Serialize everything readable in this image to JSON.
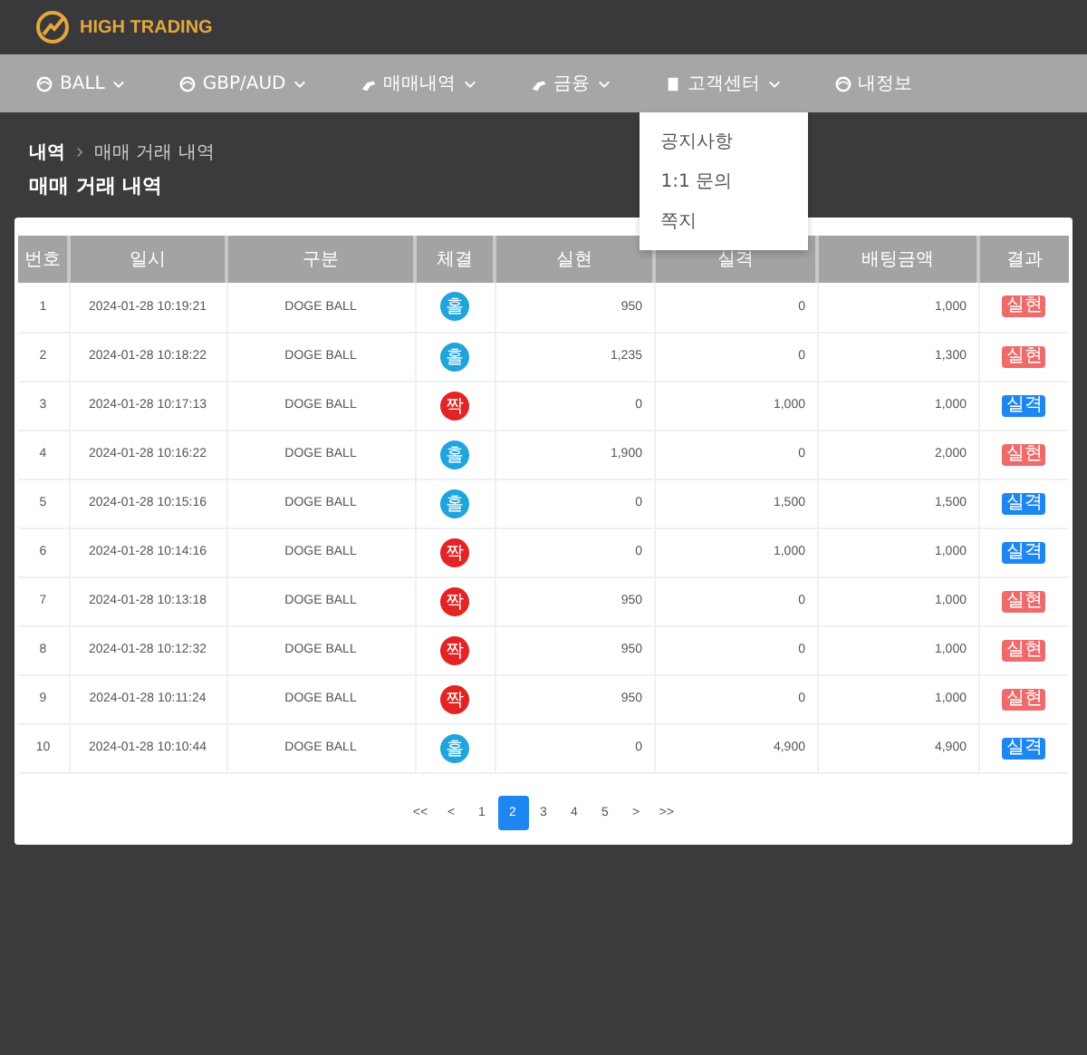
{
  "brand": {
    "name": "HIGH TRADING"
  },
  "nav": [
    {
      "label": "BALL",
      "has_dropdown": true,
      "expanded": false
    },
    {
      "label": "GBP/AUD",
      "has_dropdown": true,
      "expanded": false
    },
    {
      "label": "매매내역",
      "has_dropdown": true,
      "expanded": false
    },
    {
      "label": "금융",
      "has_dropdown": true,
      "expanded": false
    },
    {
      "label": "고객센터",
      "has_dropdown": true,
      "expanded": true,
      "menu": [
        "공지사항",
        "1:1 문의",
        "쪽지"
      ]
    },
    {
      "label": "내정보",
      "has_dropdown": false,
      "expanded": false
    }
  ],
  "breadcrumb": [
    "내역",
    "매매 거래 내역"
  ],
  "page_title": "매매 거래 내역",
  "table": {
    "columns": [
      "번호",
      "일시",
      "구분",
      "체결",
      "실현",
      "실격",
      "배팅금액",
      "결과"
    ],
    "rows": [
      {
        "no": "1",
        "time": "2024-01-28 10:19:21",
        "type": "DOGE BALL",
        "pick": {
          "label": "홀",
          "kind": "odd"
        },
        "realized": "950",
        "lost": "0",
        "bet": "1,000",
        "result": {
          "label": "실현",
          "kind": "win"
        }
      },
      {
        "no": "2",
        "time": "2024-01-28 10:18:22",
        "type": "DOGE BALL",
        "pick": {
          "label": "홀",
          "kind": "odd"
        },
        "realized": "1,235",
        "lost": "0",
        "bet": "1,300",
        "result": {
          "label": "실현",
          "kind": "win"
        }
      },
      {
        "no": "3",
        "time": "2024-01-28 10:17:13",
        "type": "DOGE BALL",
        "pick": {
          "label": "짝",
          "kind": "even"
        },
        "realized": "0",
        "lost": "1,000",
        "bet": "1,000",
        "result": {
          "label": "실격",
          "kind": "loss"
        }
      },
      {
        "no": "4",
        "time": "2024-01-28 10:16:22",
        "type": "DOGE BALL",
        "pick": {
          "label": "홀",
          "kind": "odd"
        },
        "realized": "1,900",
        "lost": "0",
        "bet": "2,000",
        "result": {
          "label": "실현",
          "kind": "win"
        }
      },
      {
        "no": "5",
        "time": "2024-01-28 10:15:16",
        "type": "DOGE BALL",
        "pick": {
          "label": "홀",
          "kind": "odd"
        },
        "realized": "0",
        "lost": "1,500",
        "bet": "1,500",
        "result": {
          "label": "실격",
          "kind": "loss"
        }
      },
      {
        "no": "6",
        "time": "2024-01-28 10:14:16",
        "type": "DOGE BALL",
        "pick": {
          "label": "짝",
          "kind": "even"
        },
        "realized": "0",
        "lost": "1,000",
        "bet": "1,000",
        "result": {
          "label": "실격",
          "kind": "loss"
        }
      },
      {
        "no": "7",
        "time": "2024-01-28 10:13:18",
        "type": "DOGE BALL",
        "pick": {
          "label": "짝",
          "kind": "even"
        },
        "realized": "950",
        "lost": "0",
        "bet": "1,000",
        "result": {
          "label": "실현",
          "kind": "win"
        }
      },
      {
        "no": "8",
        "time": "2024-01-28 10:12:32",
        "type": "DOGE BALL",
        "pick": {
          "label": "짝",
          "kind": "even"
        },
        "realized": "950",
        "lost": "0",
        "bet": "1,000",
        "result": {
          "label": "실현",
          "kind": "win"
        }
      },
      {
        "no": "9",
        "time": "2024-01-28 10:11:24",
        "type": "DOGE BALL",
        "pick": {
          "label": "짝",
          "kind": "even"
        },
        "realized": "950",
        "lost": "0",
        "bet": "1,000",
        "result": {
          "label": "실현",
          "kind": "win"
        }
      },
      {
        "no": "10",
        "time": "2024-01-28 10:10:44",
        "type": "DOGE BALL",
        "pick": {
          "label": "홀",
          "kind": "odd"
        },
        "realized": "0",
        "lost": "4,900",
        "bet": "4,900",
        "result": {
          "label": "실격",
          "kind": "loss"
        }
      }
    ]
  },
  "pagination": [
    {
      "label": "<<",
      "selected": false
    },
    {
      "label": "<",
      "selected": false
    },
    {
      "label": "1",
      "selected": false
    },
    {
      "label": "2",
      "selected": true
    },
    {
      "label": "3",
      "selected": false
    },
    {
      "label": "4",
      "selected": false
    },
    {
      "label": "5",
      "selected": false
    },
    {
      "label": ">",
      "selected": false
    },
    {
      "label": ">>",
      "selected": false
    }
  ]
}
